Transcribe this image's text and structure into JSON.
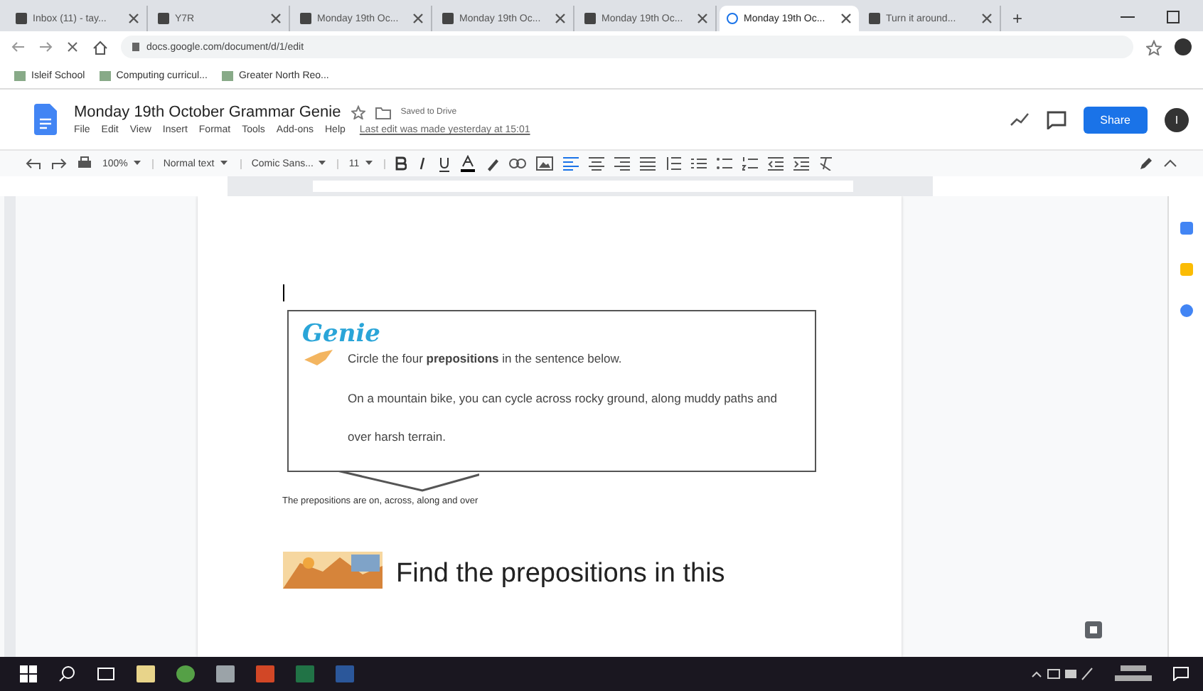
{
  "browser": {
    "tabs": [
      {
        "label": "Inbox (11) - tay...",
        "selected": false
      },
      {
        "label": "Y7R",
        "selected": false
      },
      {
        "label": "Monday 19th Oc...",
        "selected": false
      },
      {
        "label": "Monday 19th Oc...",
        "selected": false
      },
      {
        "label": "Monday 19th Oc...",
        "selected": false
      },
      {
        "label": "Monday 19th Oc...",
        "selected": true
      },
      {
        "label": "Turn it around...",
        "selected": false
      }
    ],
    "new_tab": "+",
    "url": "docs.google.com/document/d/1/edit",
    "bookmarks": [
      "Isleif School",
      "Computing curricul...",
      "Greater North Reo..."
    ]
  },
  "doc": {
    "title": "Monday 19th October Grammar Genie",
    "saved": "Saved to Drive",
    "menu": [
      "File",
      "Edit",
      "View",
      "Insert",
      "Format",
      "Tools",
      "Add-ons",
      "Help"
    ],
    "last_edit": "Last edit was made yesterday at 15:01",
    "share": "Share",
    "avatar": "I",
    "toolbar": {
      "zoom": "100%",
      "style": "Normal text",
      "font": "Comic Sans...",
      "size": "11"
    }
  },
  "page": {
    "genie": "Genie",
    "instruction": "Circle the four **prepositions** in the sentence below.",
    "sentence": "On a mountain bike, you can cycle across rocky ground, along muddy paths and over harsh terrain.",
    "answer": "The prepositions are on, across, along and over",
    "heading": "Find the prepositions in this"
  }
}
